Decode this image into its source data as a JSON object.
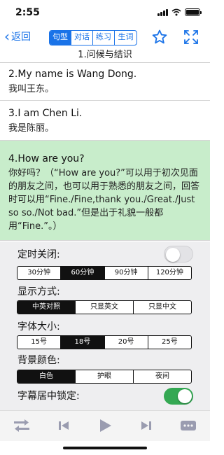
{
  "status": {
    "time": "2:55"
  },
  "nav": {
    "back_label": "返回",
    "tabs": [
      {
        "label": "句型",
        "active": true
      },
      {
        "label": "对话",
        "active": false
      },
      {
        "label": "练习",
        "active": false
      },
      {
        "label": "生词",
        "active": false
      }
    ],
    "star_icon": "star-outline-icon",
    "expand_icon": "expand-arrows-icon"
  },
  "section_title": "1.问候与结识",
  "sentences": [
    {
      "en": "2.My name is Wang Dong.",
      "zh": "我叫王东。"
    },
    {
      "en": "3.I am Chen Li.",
      "zh": "我是陈丽。"
    },
    {
      "en": "4.How are you?",
      "zh": "你好吗？（“How are you?”可以用于初次见面的朋友之间，也可以用于熟悉的朋友之间，回答时可以用“Fine./Fine,thank you./Great./Just so so./Not bad.”但是出于礼貌一般都用“Fine.”。）"
    }
  ],
  "settings": {
    "timer": {
      "label": "定时关闭:",
      "enabled": false,
      "options": [
        "30分钟",
        "60分钟",
        "90分钟",
        "120分钟"
      ],
      "selected": 1
    },
    "display": {
      "label": "显示方式:",
      "options": [
        "中英对照",
        "只显英文",
        "只显中文"
      ],
      "selected": 0
    },
    "font": {
      "label": "字体大小:",
      "options": [
        "15号",
        "18号",
        "20号",
        "25号"
      ],
      "selected": 1
    },
    "background": {
      "label": "背景颜色:",
      "options": [
        "白色",
        "护眼",
        "夜间"
      ],
      "selected": 0
    },
    "center_lock": {
      "label": "字幕居中锁定:",
      "enabled": true
    }
  },
  "player": {
    "icons": [
      "shuffle-icon",
      "skip-back-icon",
      "play-icon",
      "skip-forward-icon",
      "more-icon"
    ]
  },
  "colors": {
    "accent": "#1a73e8",
    "highlight": "#c8edcb",
    "toggle_on": "#34a853",
    "player_icon": "#9a9cb0"
  }
}
